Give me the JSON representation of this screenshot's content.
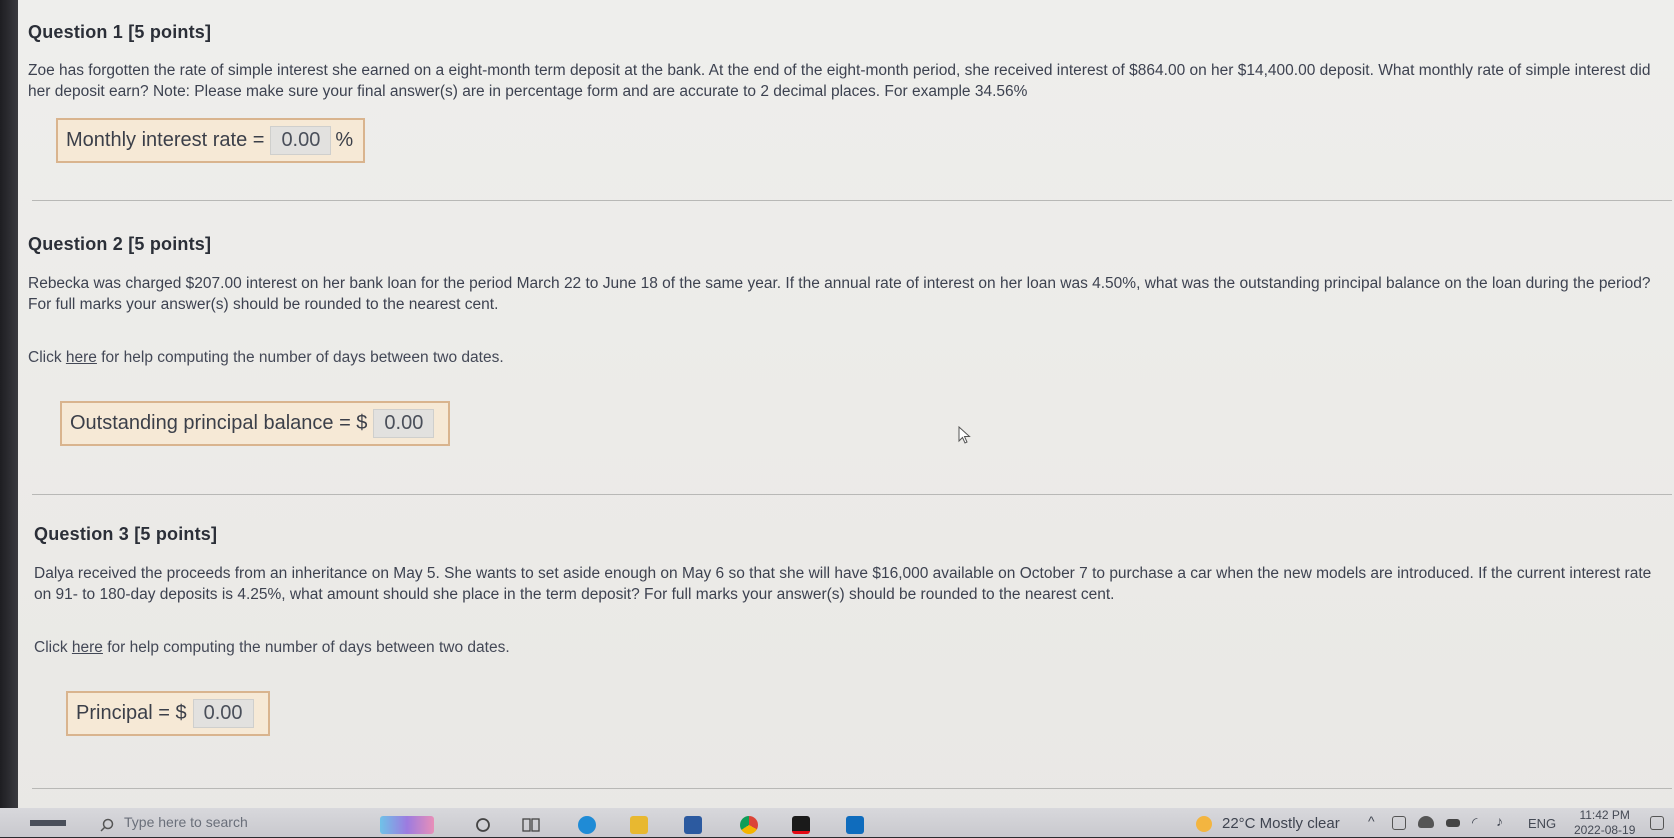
{
  "questions": [
    {
      "title": "Question 1 [5 points]",
      "body": "Zoe has forgotten the rate of simple interest she earned on a eight-month term deposit at the bank. At the end of the eight-month period, she received interest of $864.00 on her $14,400.00 deposit. What monthly rate of simple interest did her deposit earn? Note: Please make sure your final answer(s) are in percentage form and are accurate to 2 decimal places. For example 34.56%",
      "answer_label": "Monthly interest rate =",
      "answer_value": "0.00",
      "answer_suffix": "%"
    },
    {
      "title": "Question 2 [5 points]",
      "body": "Rebecka was charged $207.00 interest on her bank loan for the period March 22 to June 18 of the same year. If the annual rate of interest on her loan was 4.50%, what was the outstanding principal balance on the loan during the period? For full marks your answer(s) should be rounded to the nearest cent.",
      "help_prefix": "Click",
      "help_link": "here",
      "help_suffix": "for help computing the number of days between two dates.",
      "answer_label": "Outstanding principal balance = $",
      "answer_value": "0.00"
    },
    {
      "title": "Question 3 [5 points]",
      "body": "Dalya received the proceeds from an inheritance on May 5. She wants to set aside enough on May 6 so that she will have $16,000 available on October 7 to purchase a car when the new models are introduced. If the current interest rate on 91- to 180-day deposits is 4.25%, what amount should she place in the term deposit? For full marks your answer(s) should be rounded to the nearest cent.",
      "help_prefix": "Click",
      "help_link": "here",
      "help_suffix": "for help computing the number of days between two dates.",
      "answer_label": "Principal = $",
      "answer_value": "0.00"
    }
  ],
  "taskbar": {
    "search_placeholder": "Type here to search",
    "weather": "22°C  Mostly clear",
    "language": "ENG",
    "time": "11:42 PM",
    "date": "2022-08-19"
  },
  "colors": {
    "answer_box_bg": "#f6e9d6",
    "answer_box_border": "#d9b48e",
    "page_bg": "#eeeeec"
  }
}
